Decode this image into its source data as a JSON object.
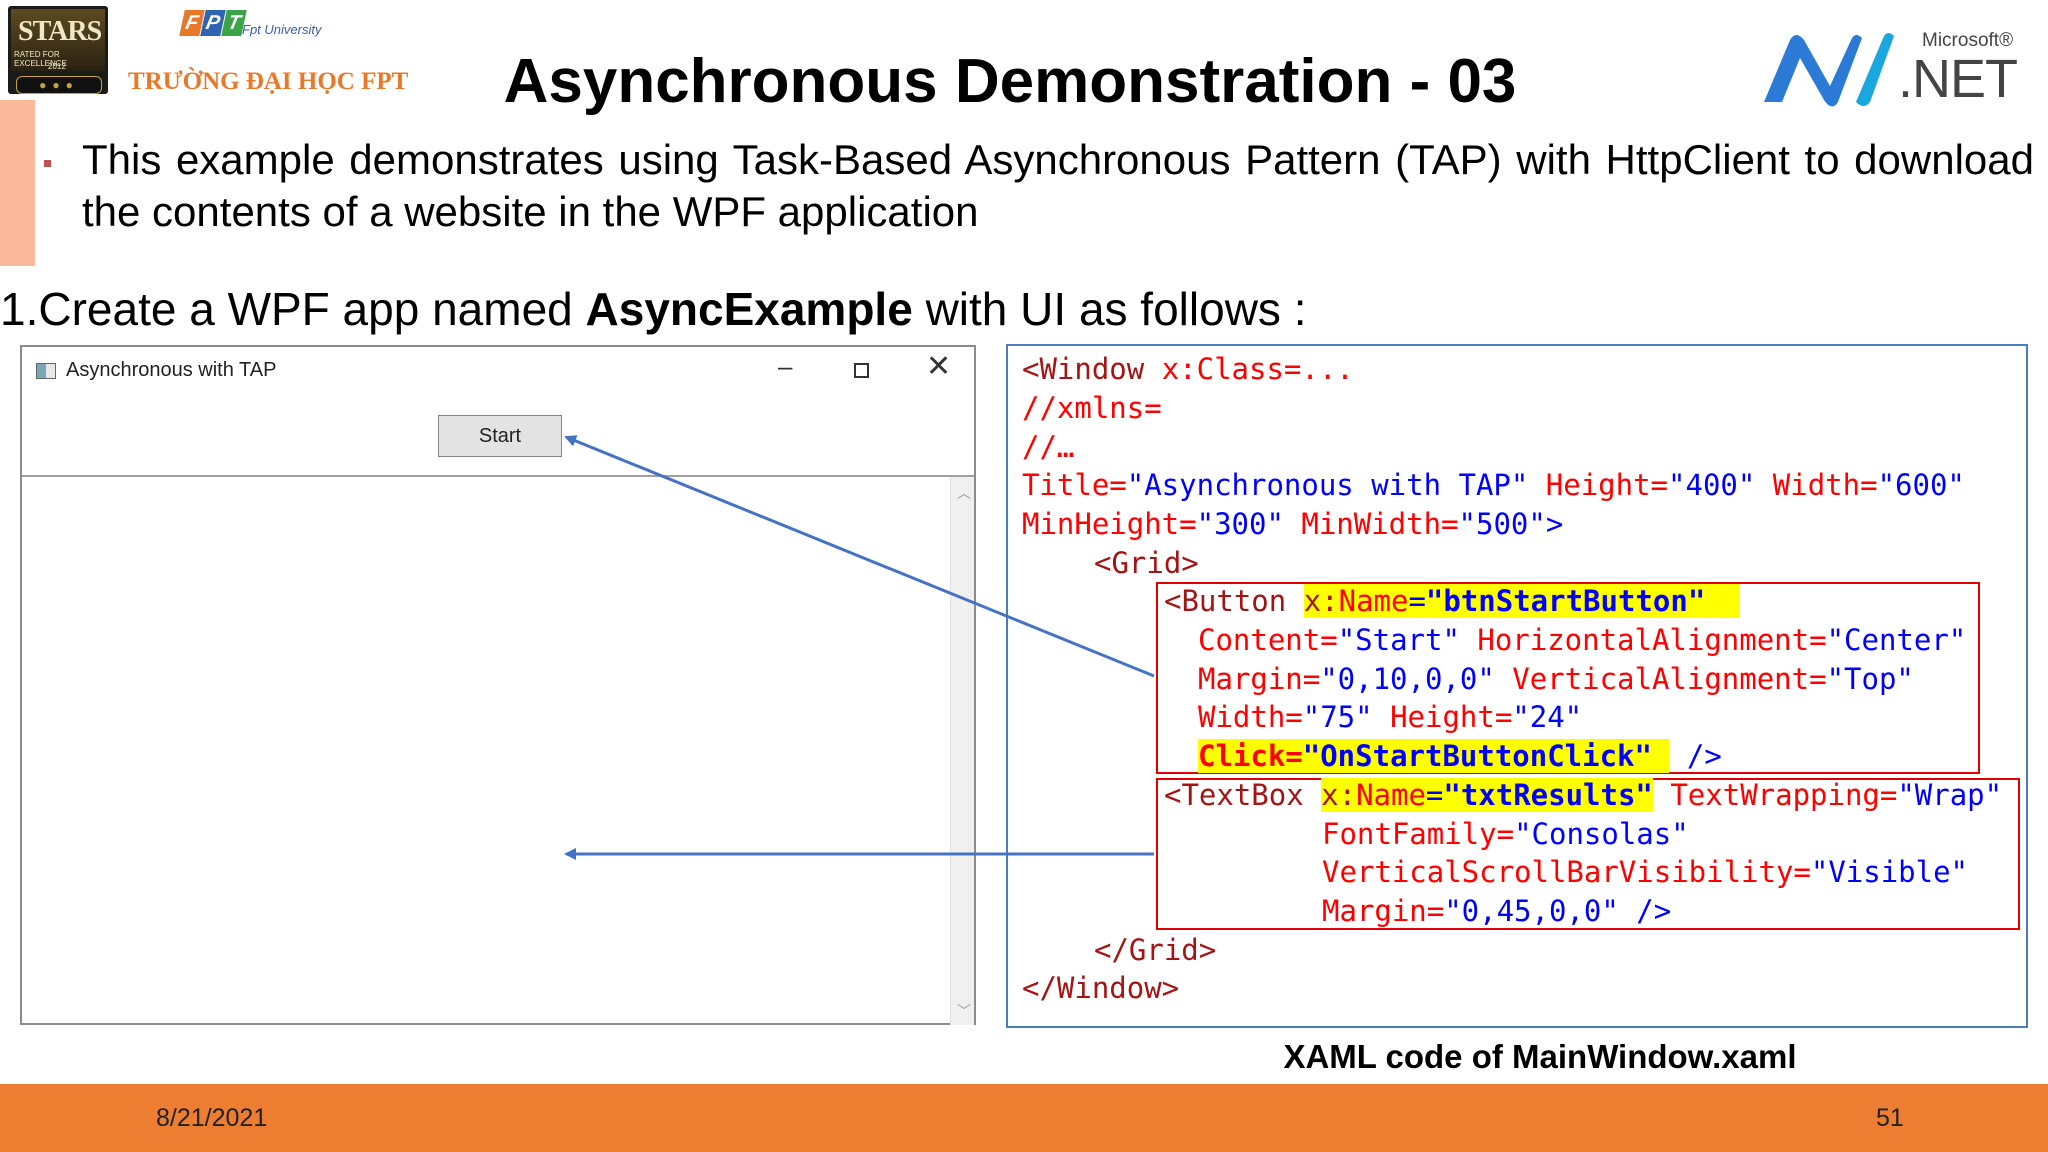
{
  "header": {
    "title": "Asynchronous Demonstration - 03",
    "stars_logo_text": "STARS",
    "stars_logo_caption": "RATED FOR EXCELLENCE",
    "stars_logo_year": "2012",
    "fpt_letters": [
      "F",
      "P",
      "T"
    ],
    "fpt_university": "Fpt University",
    "fpt_school": "TRƯỜNG ĐẠI HỌC FPT",
    "net_logo_brand": "Microsoft®",
    "net_logo_product": ".NET",
    "brand_colors": {
      "accent_orange": "#ed7d31",
      "fpt_orange": "#e8782a",
      "fpt_blue": "#2f64b3",
      "fpt_green": "#3aa447",
      "net_blue": "#2b7bd6"
    }
  },
  "bullet": {
    "text": "This example demonstrates using Task-Based Asynchronous Pattern (TAP) with HttpClient to download the contents of a website in the WPF application"
  },
  "step": {
    "prefix": "1.Create a WPF app named ",
    "app_name": "AsyncExample",
    "suffix": " with UI as follows :"
  },
  "wpf_window": {
    "title": "Asynchronous with TAP",
    "minimize_glyph": "–",
    "close_glyph": "✕",
    "start_button_label": "Start",
    "scroll_up_glyph": "︿",
    "scroll_down_glyph": "﹀"
  },
  "code": {
    "l1": {
      "a": "<Window ",
      "b": "x:Class=..."
    },
    "l2": "//xmlns=",
    "l3": "//…",
    "l4": {
      "a": "Title=",
      "b": "\"Asynchronous with TAP\"",
      "c": " Height=",
      "d": "\"400\"",
      "e": " Width=",
      "f": "\"600\""
    },
    "l5": {
      "a": "MinHeight=",
      "b": "\"300\"",
      "c": " MinWidth=",
      "d": "\"500\"",
      "e": ">"
    },
    "l6": "<Grid>",
    "l7": {
      "a": "<Button ",
      "b": "x:",
      "c": "Name",
      "d": "=",
      "e": "\"btnStartButton\""
    },
    "l8": {
      "a": "Content=",
      "b": "\"Start\"",
      "c": " HorizontalAlignment=",
      "d": "\"Center\""
    },
    "l9": {
      "a": "Margin=",
      "b": "\"0,10,0,0\"",
      "c": " VerticalAlignment=",
      "d": "\"Top\""
    },
    "l10": {
      "a": "Width=",
      "b": "\"75\"",
      "c": " Height=",
      "d": "\"24\""
    },
    "l11": {
      "a": "Click=",
      "b": "\"OnStartButtonClick\"",
      "c": " />"
    },
    "l12": {
      "a": "<TextBox ",
      "b": "x:",
      "c": "Name",
      "d": "=",
      "e": "\"txtResults\"",
      "f": " TextWrapping=",
      "g": "\"Wrap\""
    },
    "l13": {
      "a": "FontFamily=",
      "b": "\"Consolas\""
    },
    "l14": {
      "a": "VerticalScrollBarVisibility=",
      "b": "\"Visible\""
    },
    "l15": {
      "a": "Margin=",
      "b": "\"0,45,0,0\"",
      "c": " />"
    },
    "l16": "</Grid>",
    "l17": "</Window>"
  },
  "code_caption": "XAML code of MainWindow.xaml",
  "footer": {
    "date": "8/21/2021",
    "page_number": "51"
  }
}
